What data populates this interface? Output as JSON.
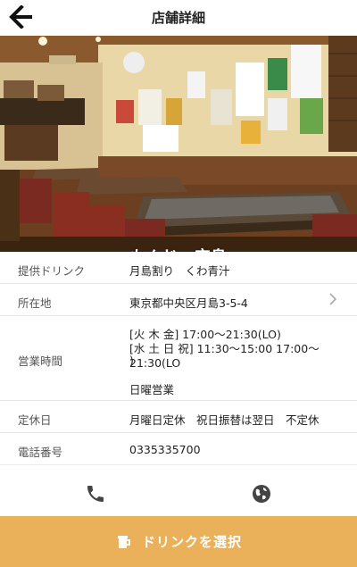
{
  "header": {
    "title": "店舗詳細",
    "back_icon": "arrow-left-icon"
  },
  "hero": {
    "shop_name": "もんじゃ宝島",
    "photo_label": "restaurant interior photo"
  },
  "details": {
    "drink": {
      "label": "提供ドリンク",
      "value": "月島割り　くわ青汁"
    },
    "address": {
      "label": "所在地",
      "value": "東京都中央区月島3-5-4"
    },
    "hours": {
      "label": "営業時間",
      "line1": "[火 木 金] 17:00〜21:30(LO)",
      "line2": "[水 土 日 祝] 11:30〜15:00 17:00〜21:30(LO",
      "line3": ")",
      "line4": "日曜営業"
    },
    "closed": {
      "label": "定休日",
      "value": "月曜日定休　祝日振替は翌日　不定休"
    },
    "phone": {
      "label": "電話番号",
      "value": "0335335700"
    }
  },
  "actions": {
    "phone_icon": "phone-icon",
    "web_icon": "globe-icon"
  },
  "footer": {
    "select_label": "ドリンクを選択",
    "button_color": "#ebb15a"
  }
}
